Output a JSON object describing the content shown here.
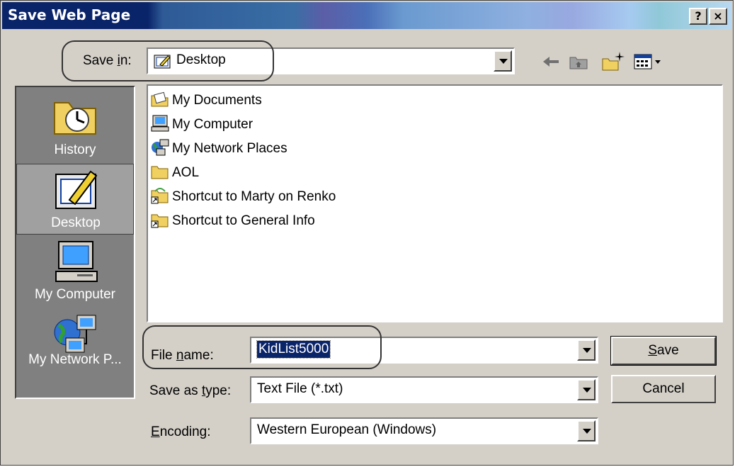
{
  "window": {
    "title": "Save Web Page",
    "help_label": "?",
    "close_label": "×"
  },
  "savein": {
    "label_pre": "Save ",
    "label_ul": "i",
    "label_post": "n:",
    "value": "Desktop"
  },
  "places": [
    {
      "label": "History",
      "icon": "history-folder-icon",
      "selected": false
    },
    {
      "label": "Desktop",
      "icon": "desktop-icon",
      "selected": true
    },
    {
      "label": "My Computer",
      "icon": "computer-icon",
      "selected": false
    },
    {
      "label": "My Network P...",
      "icon": "network-places-icon",
      "selected": false
    }
  ],
  "files": [
    {
      "name": "My Documents",
      "icon": "my-documents-icon"
    },
    {
      "name": "My Computer",
      "icon": "computer-icon"
    },
    {
      "name": "My Network Places",
      "icon": "network-places-icon"
    },
    {
      "name": "AOL",
      "icon": "folder-icon"
    },
    {
      "name": "Shortcut to Marty on Renko",
      "icon": "shortcut-shared-folder-icon"
    },
    {
      "name": "Shortcut to General Info",
      "icon": "shortcut-folder-icon"
    }
  ],
  "filename": {
    "label_pre": "File ",
    "label_ul": "n",
    "label_post": "ame:",
    "value": "KidList5000"
  },
  "savetype": {
    "label_pre": "Save as ",
    "label_ul": "t",
    "label_post": "ype:",
    "value": "Text File (*.txt)"
  },
  "encoding": {
    "label_ul": "E",
    "label_post": "ncoding:",
    "value": "Western European (Windows)"
  },
  "buttons": {
    "save_ul": "S",
    "save_post": "ave",
    "cancel": "Cancel"
  },
  "colors": {
    "selection": "#0a246a",
    "face": "#d4d0c8"
  }
}
